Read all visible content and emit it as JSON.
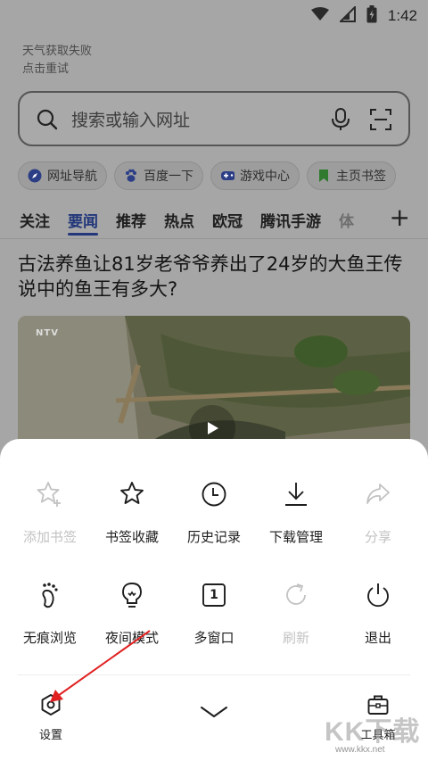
{
  "status_bar": {
    "time": "1:42"
  },
  "weather": {
    "line1": "天气获取失败",
    "line2": "点击重试"
  },
  "search": {
    "placeholder": "搜索或输入网址"
  },
  "quick_links": [
    {
      "label": "网址导航",
      "icon": "compass-icon"
    },
    {
      "label": "百度一下",
      "icon": "paw-icon"
    },
    {
      "label": "游戏中心",
      "icon": "gamepad-icon"
    },
    {
      "label": "主页书签",
      "icon": "bookmark-icon"
    }
  ],
  "news_tabs": [
    "关注",
    "要闻",
    "推荐",
    "热点",
    "欧冠",
    "腾讯手游",
    "体"
  ],
  "active_tab": "要闻",
  "headline": "古法养鱼让81岁老爷爷养出了24岁的大鱼王传说中的鱼王有多大?",
  "video_badge": "NTV",
  "menu": {
    "row1": [
      {
        "label": "添加书签",
        "icon": "star-plus-icon",
        "enabled": false
      },
      {
        "label": "书签收藏",
        "icon": "star-icon",
        "enabled": true
      },
      {
        "label": "历史记录",
        "icon": "clock-icon",
        "enabled": true
      },
      {
        "label": "下载管理",
        "icon": "download-icon",
        "enabled": true
      },
      {
        "label": "分享",
        "icon": "share-icon",
        "enabled": false
      }
    ],
    "row2": [
      {
        "label": "无痕浏览",
        "icon": "footprint-icon",
        "enabled": true
      },
      {
        "label": "夜间模式",
        "icon": "bulb-icon",
        "enabled": true
      },
      {
        "label": "多窗口",
        "icon": "window-count-icon",
        "enabled": true,
        "count": "1"
      },
      {
        "label": "刷新",
        "icon": "refresh-icon",
        "enabled": false
      },
      {
        "label": "退出",
        "icon": "power-icon",
        "enabled": true
      }
    ]
  },
  "bottom": {
    "settings": "设置",
    "toolbox": "工具箱"
  },
  "watermark": {
    "text": "KK下载",
    "url": "www.kkx.net"
  },
  "colors": {
    "accent": "#23377a",
    "arrow": "#e02020",
    "disabled": "#c2c2c2"
  }
}
